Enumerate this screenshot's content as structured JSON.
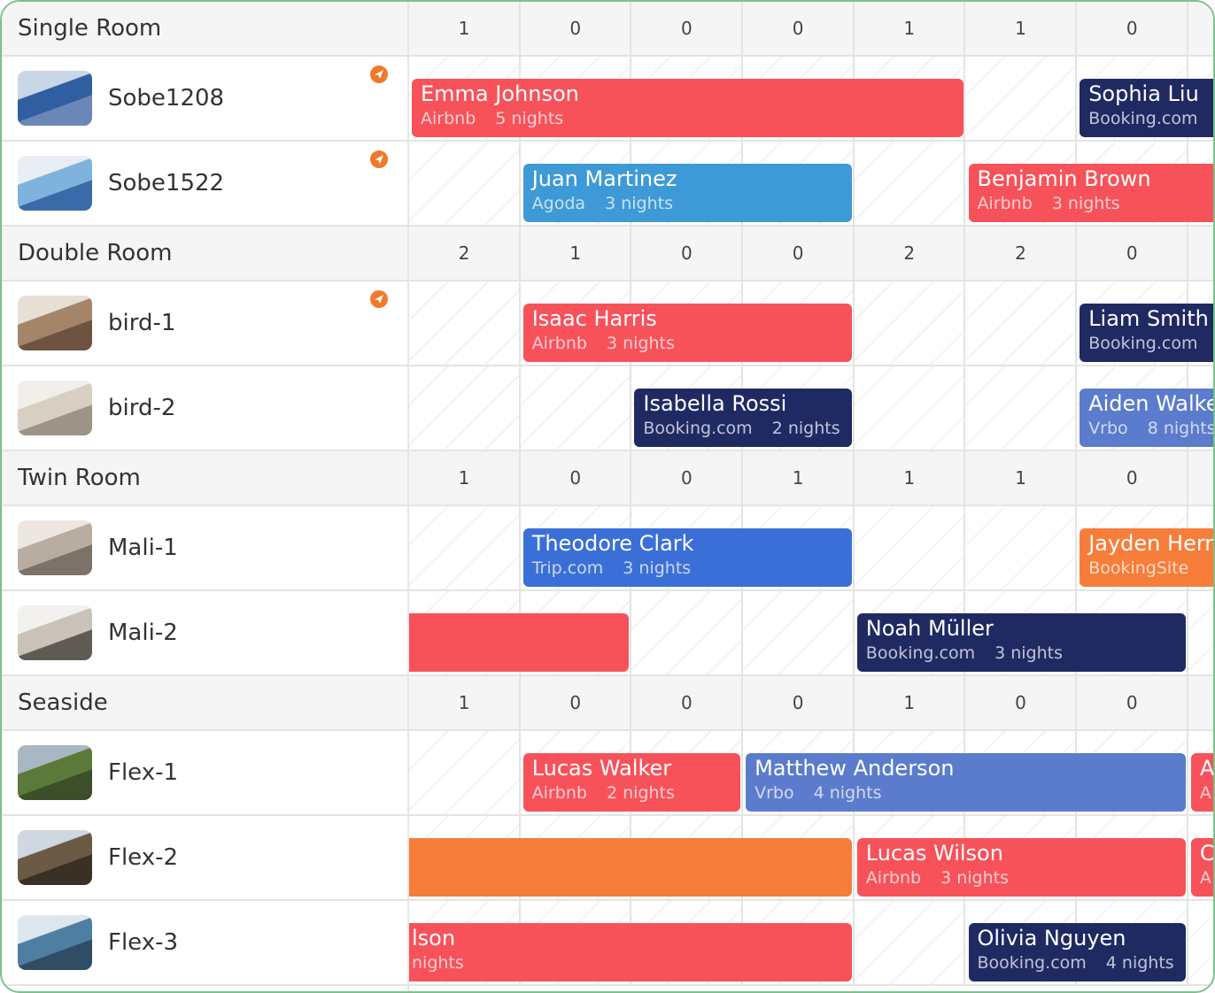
{
  "colors": {
    "airbnb": "#f7525a",
    "booking": "#1f2a63",
    "agoda": "#3e9ad6",
    "trip": "#3b6fd8",
    "vrbo": "#5b7ccc",
    "bookingsite": "#f77d3a",
    "frame": "#7ac38a",
    "sync_icon": "#f07a2a"
  },
  "groups": [
    {
      "label": "Single Room",
      "counts": [
        "1",
        "0",
        "0",
        "0",
        "1",
        "1",
        "0"
      ],
      "rooms": [
        {
          "name": "Sobe1208",
          "sync_icon": "paper-plane-icon",
          "thumb": "bedroom-photo-blue",
          "bookings": [
            {
              "guest": "Emma Johnson",
              "source": "Airbnb",
              "nights": "5 nights",
              "start": 0,
              "span": 5,
              "channel": "airbnb"
            },
            {
              "guest": "Sophia Liu",
              "source": "Booking.com",
              "nights": "",
              "start": 6,
              "span": 2,
              "channel": "booking"
            }
          ]
        },
        {
          "name": "Sobe1522",
          "sync_icon": "paper-plane-icon",
          "thumb": "bedroom-photo-bright",
          "bookings": [
            {
              "guest": "Juan Martinez",
              "source": "Agoda",
              "nights": "3 nights",
              "start": 1,
              "span": 3,
              "channel": "agoda"
            },
            {
              "guest": "Benjamin Brown",
              "source": "Airbnb",
              "nights": "3 nights",
              "start": 5,
              "span": 3,
              "channel": "airbnb"
            }
          ]
        }
      ]
    },
    {
      "label": "Double Room",
      "counts": [
        "2",
        "1",
        "0",
        "0",
        "2",
        "2",
        "0"
      ],
      "rooms": [
        {
          "name": "bird-1",
          "sync_icon": "paper-plane-icon",
          "thumb": "bedroom-photo-wood",
          "bookings": [
            {
              "guest": "Isaac Harris",
              "source": "Airbnb",
              "nights": "3 nights",
              "start": 1,
              "span": 3,
              "channel": "airbnb"
            },
            {
              "guest": "Liam Smith",
              "source": "Booking.com",
              "nights": "",
              "start": 6,
              "span": 2,
              "channel": "booking"
            }
          ]
        },
        {
          "name": "bird-2",
          "sync_icon": "",
          "thumb": "bedroom-photo-light",
          "bookings": [
            {
              "guest": "Isabella Rossi",
              "source": "Booking.com",
              "nights": "2 nights",
              "start": 2,
              "span": 2,
              "channel": "booking"
            },
            {
              "guest": "Aiden Walke",
              "source": "Vrbo",
              "nights": "8 nights",
              "start": 6,
              "span": 2,
              "channel": "vrbo"
            }
          ]
        }
      ]
    },
    {
      "label": "Twin Room",
      "counts": [
        "1",
        "0",
        "0",
        "1",
        "1",
        "1",
        "0"
      ],
      "rooms": [
        {
          "name": "Mali-1",
          "sync_icon": "",
          "thumb": "bedroom-photo-neutral",
          "bookings": [
            {
              "guest": "Theodore Clark",
              "source": "Trip.com",
              "nights": "3 nights",
              "start": 1,
              "span": 3,
              "channel": "trip"
            },
            {
              "guest": "Jayden Hern",
              "source": "BookingSite",
              "nights": "",
              "start": 6,
              "span": 2,
              "channel": "bookingsite"
            }
          ]
        },
        {
          "name": "Mali-2",
          "sync_icon": "",
          "thumb": "bedroom-photo-twin",
          "bookings": [
            {
              "guest": "",
              "source": "",
              "nights": "",
              "start": -1,
              "span": 3,
              "channel": "airbnb"
            },
            {
              "guest": "Noah Müller",
              "source": "Booking.com",
              "nights": "3 nights",
              "start": 4,
              "span": 3,
              "channel": "booking"
            }
          ]
        }
      ]
    },
    {
      "label": "Seaside",
      "counts": [
        "1",
        "0",
        "0",
        "0",
        "1",
        "0",
        "0"
      ],
      "rooms": [
        {
          "name": "Flex-1",
          "sync_icon": "",
          "thumb": "garden-path-photo",
          "bookings": [
            {
              "guest": "Lucas Walker",
              "source": "Airbnb",
              "nights": "2 nights",
              "start": 1,
              "span": 2,
              "channel": "airbnb"
            },
            {
              "guest": "Matthew Anderson",
              "source": "Vrbo",
              "nights": "4 nights",
              "start": 3,
              "span": 4,
              "channel": "vrbo"
            },
            {
              "guest": "A",
              "source": "A",
              "nights": "",
              "start": 7,
              "span": 1,
              "channel": "airbnb"
            }
          ]
        },
        {
          "name": "Flex-2",
          "sync_icon": "",
          "thumb": "fence-photo",
          "bookings": [
            {
              "guest": "",
              "source": "",
              "nights": "",
              "start": -1,
              "span": 5,
              "channel": "bookingsite"
            },
            {
              "guest": "Lucas Wilson",
              "source": "Airbnb",
              "nights": "3 nights",
              "start": 4,
              "span": 3,
              "channel": "airbnb"
            },
            {
              "guest": "C",
              "source": "A",
              "nights": "",
              "start": 7,
              "span": 1,
              "channel": "airbnb"
            }
          ]
        },
        {
          "name": "Flex-3",
          "sync_icon": "",
          "thumb": "bathroom-photo",
          "bookings": [
            {
              "guest": "lson",
              "source": "nights",
              "nights": "",
              "start": -1,
              "span": 5,
              "channel": "airbnb"
            },
            {
              "guest": "Olivia Nguyen",
              "source": "Booking.com",
              "nights": "4 nights",
              "start": 5,
              "span": 2,
              "channel": "booking"
            }
          ]
        }
      ]
    }
  ]
}
